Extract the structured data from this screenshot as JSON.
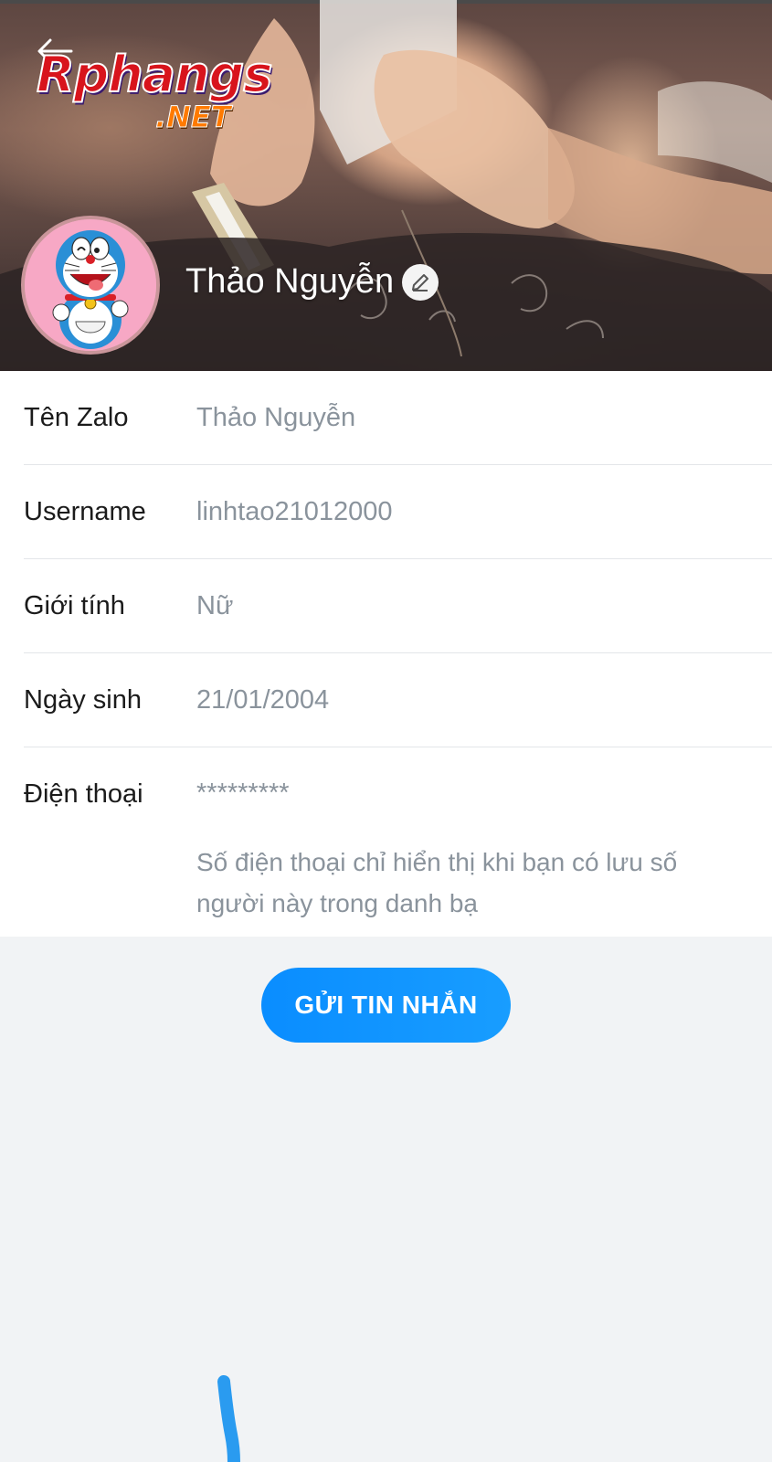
{
  "header": {
    "back_icon": "arrow-left-icon",
    "watermark": {
      "main": "Rphangs",
      "suffix": ".NET"
    },
    "avatar_icon": "doraemon-avatar",
    "name": "Thảo Nguyễn",
    "edit_icon": "pencil-icon"
  },
  "info": {
    "rows": [
      {
        "label": "Tên Zalo",
        "value": "Thảo Nguyễn"
      },
      {
        "label": "Username",
        "value": "linhtao21012000"
      },
      {
        "label": "Giới tính",
        "value": "Nữ"
      },
      {
        "label": "Ngày sinh",
        "value": "21/01/2004"
      },
      {
        "label": "Điện thoại",
        "value": "*********"
      }
    ],
    "phone_note": "Số điện thoại chỉ hiển thị khi bạn có lưu số người này trong danh bạ"
  },
  "actions": {
    "send_message_label": "GỬI TIN NHẮN"
  },
  "colors": {
    "accent": "#0a8dff",
    "label_text": "#1b1b1b",
    "value_text": "#8a939c",
    "page_background": "#f1f3f5",
    "scribble": "#2a9bf0"
  }
}
